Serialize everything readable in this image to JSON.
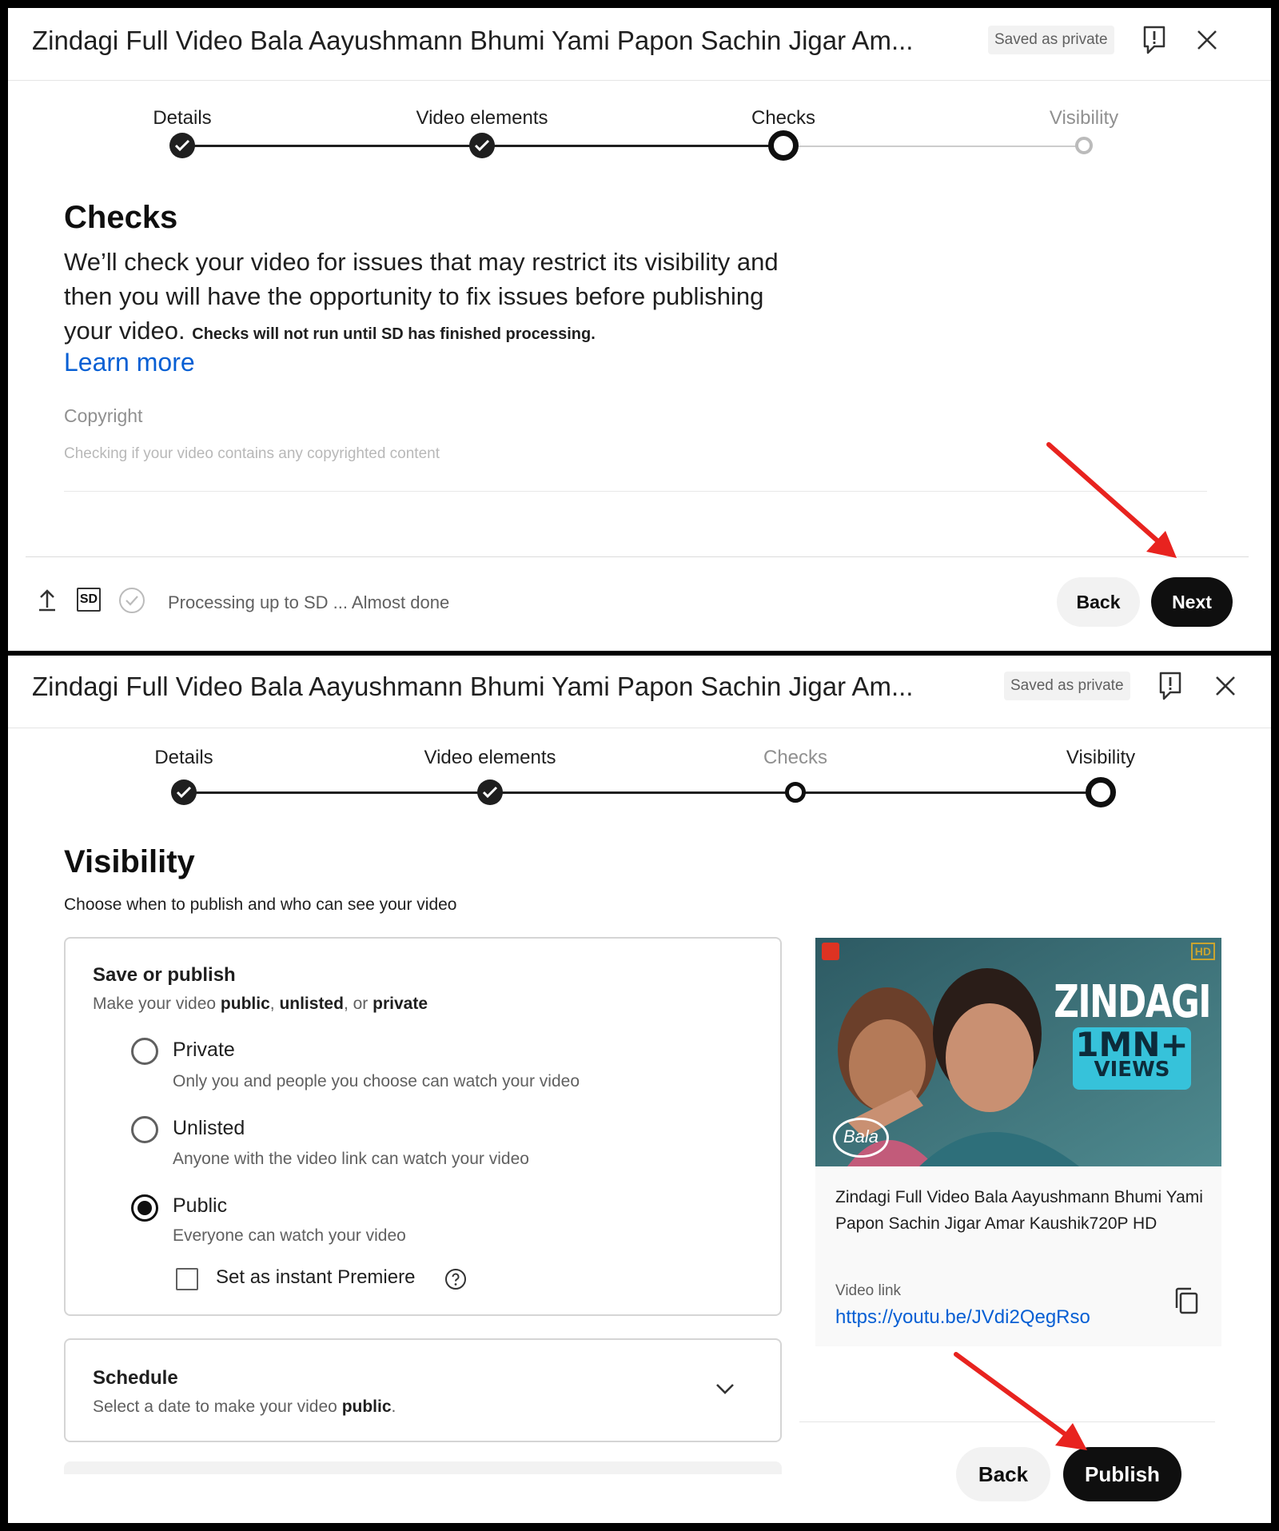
{
  "screens": [
    {
      "title": "Zindagi Full Video Bala Aayushmann Bhumi Yami Papon Sachin Jigar Am...",
      "saved_badge": "Saved as private",
      "steps": [
        {
          "label": "Details",
          "state": "done"
        },
        {
          "label": "Video elements",
          "state": "done"
        },
        {
          "label": "Checks",
          "state": "current"
        },
        {
          "label": "Visibility",
          "state": "todo"
        }
      ],
      "heading": "Checks",
      "description": "We’ll check your video for issues that may restrict its visibility and then you will have the opportunity to fix issues before publishing your video.",
      "description_small": "Checks will not run until SD has finished processing.",
      "learn_more": "Learn more",
      "copyright": {
        "title": "Copyright",
        "status": "Checking if your video contains any copyrighted content"
      },
      "footer": {
        "sd_badge": "SD",
        "processing_text": "Processing up to SD ... Almost done",
        "back_label": "Back",
        "next_label": "Next"
      }
    },
    {
      "title": "Zindagi Full Video Bala Aayushmann Bhumi Yami Papon Sachin Jigar Am...",
      "saved_badge": "Saved as private",
      "steps": [
        {
          "label": "Details",
          "state": "done"
        },
        {
          "label": "Video elements",
          "state": "done"
        },
        {
          "label": "Checks",
          "state": "visited"
        },
        {
          "label": "Visibility",
          "state": "current"
        }
      ],
      "heading": "Visibility",
      "description": "Choose when to publish and who can see your video",
      "save_or_publish": {
        "title": "Save or publish",
        "subtitle_prefix": "Make your video ",
        "subtitle_public": "public",
        "subtitle_sep1": ", ",
        "subtitle_unlisted": "unlisted",
        "subtitle_sep2": ", or ",
        "subtitle_private": "private",
        "options": [
          {
            "label": "Private",
            "description": "Only you and people you choose can watch your video",
            "selected": false
          },
          {
            "label": "Unlisted",
            "description": "Anyone with the video link can watch your video",
            "selected": false
          },
          {
            "label": "Public",
            "description": "Everyone can watch your video",
            "selected": true
          }
        ],
        "premiere_label": "Set as instant Premiere",
        "premiere_checked": false
      },
      "schedule": {
        "title": "Schedule",
        "subtitle_prefix": "Select a date to make your video ",
        "subtitle_bold": "public",
        "subtitle_suffix": "."
      },
      "preview": {
        "thumbnail_text": "ZINDAGI",
        "thumbnail_badge_top": "1MN+",
        "thumbnail_badge_bottom": "VIEWS",
        "thumbnail_hd": "HD",
        "thumbnail_logo": "Bala",
        "video_title": "Zindagi Full Video Bala Aayushmann Bhumi Yami Papon Sachin Jigar Amar Kaushik720P HD",
        "link_label": "Video link",
        "link": "https://youtu.be/JVdi2QegRso"
      },
      "footer": {
        "back_label": "Back",
        "publish_label": "Publish"
      }
    }
  ],
  "colors": {
    "link_blue": "#065fd4",
    "annotation_red": "#e8231f",
    "primary_button": "#0f0f0f"
  }
}
